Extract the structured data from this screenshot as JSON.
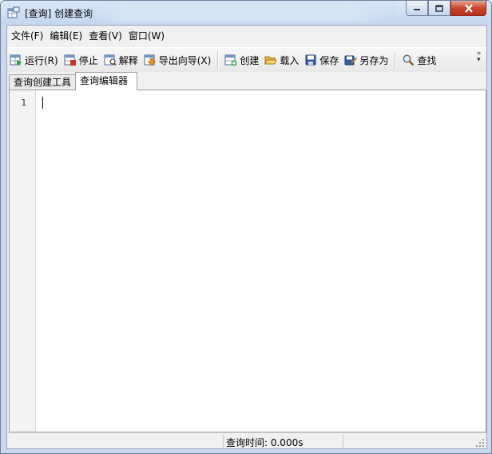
{
  "window": {
    "title": "[查询] 创建查询"
  },
  "menu": {
    "items": [
      {
        "label": "文件(F)"
      },
      {
        "label": "编辑(E)"
      },
      {
        "label": "查看(V)"
      },
      {
        "label": "窗口(W)"
      }
    ]
  },
  "toolbar": {
    "run": "运行(R)",
    "stop": "停止",
    "explain": "解释",
    "export_wizard": "导出向导(X)",
    "create": "创建",
    "load": "载入",
    "save": "保存",
    "save_as": "另存为",
    "find": "查找"
  },
  "tabs": [
    {
      "label": "查询创建工具",
      "active": false
    },
    {
      "label": "查询编辑器",
      "active": true
    }
  ],
  "editor": {
    "line_numbers": [
      "1"
    ],
    "content": ""
  },
  "status": {
    "query_time": "查询时间: 0.000s"
  },
  "colors": {
    "title_bar": "#c9daf0",
    "close_button": "#c9462c",
    "chrome": "#f0f0f0"
  }
}
